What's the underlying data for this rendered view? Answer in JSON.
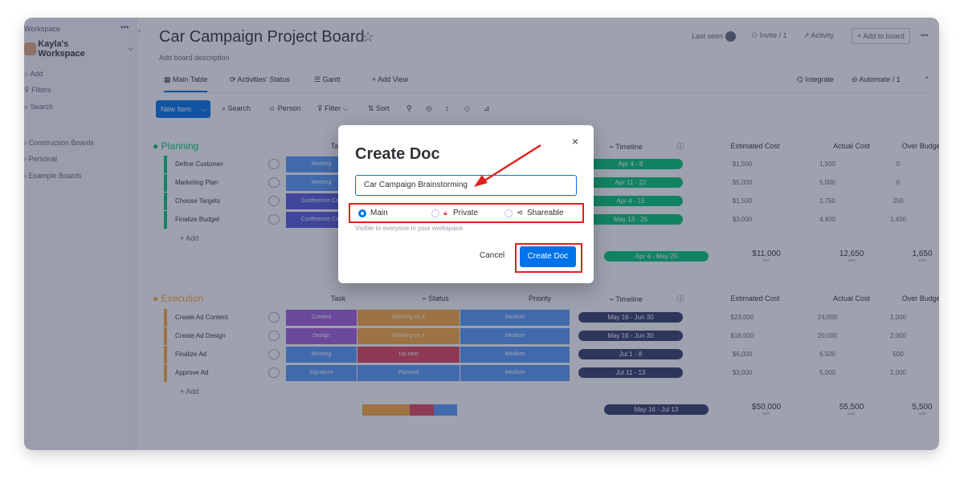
{
  "sidebar": {
    "workspace_label": "Workspace",
    "more": "•••",
    "collapse": "‹",
    "workspace_name": "Kayla's Workspace",
    "actions": [
      "Add",
      "Filters",
      "Search"
    ],
    "boards": [
      "Construction Boards",
      "Personal",
      "Example Boards"
    ]
  },
  "board": {
    "title": "Car Campaign Project Board",
    "description": "Add board description",
    "last_seen": "Last seen",
    "invite": "Invite / 1",
    "activity": "Activity",
    "add_to_board": "+ Add to board",
    "more": "•••"
  },
  "tabs": [
    "Main Table",
    "Activities' Status",
    "Gantt",
    "+ Add View"
  ],
  "tabs_right": [
    "Integrate",
    "Automate / 1"
  ],
  "toolbar": {
    "new_item": "New Item",
    "search": "Search",
    "person": "Person",
    "filter": "Filter",
    "sort": "Sort"
  },
  "columns": {
    "task": "Task",
    "status": "Status",
    "priority": "Priority",
    "timeline": "Timeline",
    "estimated_cost": "Estimated Cost",
    "actual_cost": "Actual Cost",
    "over_budget": "Over Budget"
  },
  "groups": [
    {
      "name": "Planning",
      "color": "#00c875",
      "add_label": "+ Add",
      "rows": [
        {
          "name": "Define Customer",
          "task": "Meeting",
          "task_color": "#579bfc",
          "timeline": "Apr 4 - 8",
          "est": "$1,500",
          "actual": "1,500",
          "over": "0"
        },
        {
          "name": "Marketing Plan",
          "task": "Meeting",
          "task_color": "#579bfc",
          "timeline": "Apr 11 - 22",
          "est": "$5,000",
          "actual": "5,000",
          "over": "0"
        },
        {
          "name": "Choose Targets",
          "task": "Conference Call",
          "task_color": "#5559df",
          "timeline": "Apr 4 - 15",
          "est": "$1,500",
          "actual": "1,750",
          "over": "250"
        },
        {
          "name": "Finalize Budget",
          "task": "Conference Call",
          "task_color": "#5559df",
          "timeline": "May 13 - 25",
          "est": "$3,000",
          "actual": "4,400",
          "over": "1,400"
        }
      ],
      "summary": {
        "timeline": "Apr 4 - May 25",
        "est": "$11,000",
        "actual": "12,650",
        "over": "1,650",
        "unit": "sum"
      }
    },
    {
      "name": "Execution",
      "color": "#fdab3d",
      "add_label": "+ Add",
      "rows": [
        {
          "name": "Create Ad Content",
          "task": "Content",
          "task_color": "#a25ddc",
          "status": "Working on it",
          "status_color": "#fdab3d",
          "priority": "Medium",
          "timeline": "May 16 - Jun 30",
          "est": "$23,000",
          "actual": "24,000",
          "over": "1,000"
        },
        {
          "name": "Create Ad Design",
          "task": "Design",
          "task_color": "#a25ddc",
          "status": "Working on it",
          "status_color": "#fdab3d",
          "priority": "Medium",
          "timeline": "May 16 - Jun 30",
          "est": "$18,000",
          "actual": "20,000",
          "over": "2,000"
        },
        {
          "name": "Finalize Ad",
          "task": "Meeting",
          "task_color": "#579bfc",
          "status": "Up next",
          "status_color": "#e2445c",
          "priority": "Medium",
          "timeline": "Jul 1 - 8",
          "est": "$6,000",
          "actual": "6,500",
          "over": "500"
        },
        {
          "name": "Approve Ad",
          "task": "Signature",
          "task_color": "#579bfc",
          "status": "Planned",
          "status_color": "#579bfc",
          "priority": "Medium",
          "timeline": "Jul 11 - 13",
          "est": "$3,000",
          "actual": "5,000",
          "over": "2,000"
        }
      ],
      "summary": {
        "timeline": "May 16 - Jul 13",
        "est": "$50,000",
        "actual": "55,500",
        "over": "5,500",
        "unit": "sum"
      }
    }
  ],
  "modal": {
    "title": "Create Doc",
    "close": "×",
    "input_value": "Car Campaign Brainstorming",
    "options": [
      "Main",
      "Private",
      "Shareable"
    ],
    "selected_option": "Main",
    "hint": "Visible to everyone in your workspace",
    "cancel": "Cancel",
    "create": "Create Doc"
  },
  "colors": {
    "accent": "#0073ea",
    "highlight": "#e0201b",
    "timeline_done": "#00c875",
    "timeline_dark": "#333d6b"
  }
}
